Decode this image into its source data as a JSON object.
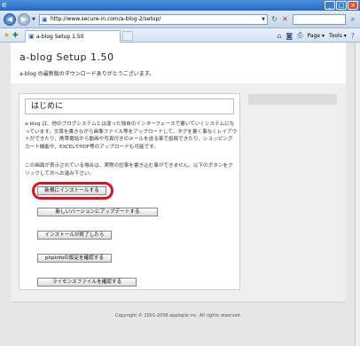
{
  "browser": {
    "address": "http://www.secure-in.com/a-blog-2/setup/",
    "tab_title": "a-blog Setup 1.50",
    "toolbar": {
      "page": "Page",
      "tools": "Tools"
    }
  },
  "page": {
    "site_title": "a-blog Setup 1.50",
    "site_subtitle": "a-blog の最新版のダウンロードありがとうございます。",
    "section_title": "はじめに",
    "description": "a-blog は、他のブログシステムとは違った独自のインターフェースで書いていくシステムになっています。文章を書きながら画像ファイル等をアップロードして、タグを書く事なくレイアウトができたり、携帯電話から動画や写真付きのメールを送る事で投稿できたり、ショッピングカート機能や、EXCELやPDF等のアップロードも可能です。",
    "note": "この画面が表示されている場合は、実際の記事を書き込む事ができません。以下のボタンをクリックして次へお進み下さい。",
    "buttons": [
      "新規にインストールする",
      "新しいバージョンにアップデートする",
      "インストールが終了したら",
      "phpinfoの設定を確認する",
      "ライセンスファイルを確認する"
    ],
    "copyright": "Copyright © 2001-2006 appleple inc. All rights reserved."
  },
  "colors": {
    "highlight": "#e0101c",
    "background": "#e6e6e6"
  }
}
